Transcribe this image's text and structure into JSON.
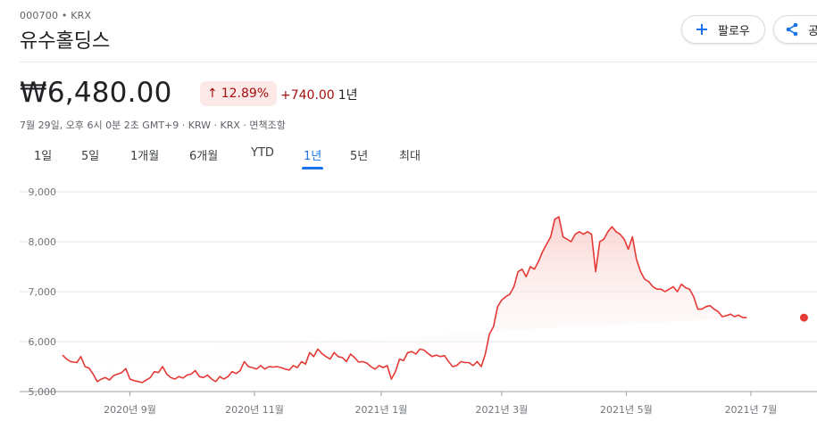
{
  "header": {
    "ticker": "000700 • KRX",
    "name": "유수홀딩스",
    "follow_label": "팔로우",
    "share_label": "공유"
  },
  "quote": {
    "price": "₩6,480.00",
    "pct_change": "12.89%",
    "change": "+740.00",
    "period": "1년",
    "meta": "7월 29일, 오후 6시 0분 2초 GMT+9 · KRW · KRX · 면책조항"
  },
  "tabs": [
    {
      "label": "1일",
      "active": false
    },
    {
      "label": "5일",
      "active": false
    },
    {
      "label": "1개월",
      "active": false
    },
    {
      "label": "6개월",
      "active": false
    },
    {
      "label": "YTD",
      "active": false
    },
    {
      "label": "1년",
      "active": true
    },
    {
      "label": "5년",
      "active": false
    },
    {
      "label": "최대",
      "active": false
    }
  ],
  "colors": {
    "line": "#e53935",
    "fill_top": "#f8c4c1",
    "down_badge_bg": "#fce8e6",
    "down_text": "#a50e0e",
    "accent": "#1a73e8"
  },
  "icons": {
    "follow": "plus-icon",
    "share": "share-icon"
  },
  "chart_data": {
    "type": "area",
    "ylim": [
      5000,
      9000
    ],
    "yticks": [
      "9,000",
      "8,000",
      "7,000",
      "6,000",
      "5,000"
    ],
    "ytick_values": [
      9000,
      8000,
      7000,
      6000,
      5000
    ],
    "xlim": [
      0,
      365
    ],
    "xticks": [
      {
        "label": "2020년 9월",
        "x": 33
      },
      {
        "label": "2020년 11월",
        "x": 94
      },
      {
        "label": "2021년 1월",
        "x": 156
      },
      {
        "label": "2021년 3월",
        "x": 215
      },
      {
        "label": "2021년 5월",
        "x": 276
      },
      {
        "label": "2021년 7월",
        "x": 337
      }
    ],
    "x": [
      0,
      2,
      4,
      7,
      9,
      11,
      13,
      15,
      17,
      19,
      21,
      23,
      25,
      27,
      29,
      31,
      33,
      35,
      37,
      39,
      41,
      43,
      45,
      47,
      49,
      51,
      53,
      55,
      57,
      59,
      61,
      63,
      65,
      67,
      69,
      71,
      73,
      75,
      77,
      79,
      81,
      83,
      85,
      87,
      89,
      91,
      93,
      95,
      97,
      99,
      101,
      103,
      105,
      107,
      109,
      111,
      113,
      115,
      117,
      119,
      121,
      123,
      125,
      127,
      129,
      131,
      133,
      135,
      137,
      139,
      141,
      143,
      145,
      147,
      149,
      151,
      153,
      155,
      157,
      159,
      161,
      163,
      165,
      167,
      169,
      171,
      173,
      175,
      177,
      179,
      181,
      183,
      185,
      187,
      189,
      191,
      193,
      195,
      197,
      199,
      201,
      203,
      205,
      207,
      209,
      211,
      213,
      215,
      217,
      219,
      221,
      223,
      225,
      227,
      229,
      231,
      233,
      235,
      237,
      239,
      241,
      243,
      245,
      247,
      249,
      251,
      253,
      255,
      257,
      259,
      261,
      263,
      265,
      267,
      269,
      271,
      273,
      275,
      277,
      279,
      281,
      283,
      285,
      287,
      289,
      291,
      293,
      295,
      297,
      299,
      301,
      303,
      305,
      307,
      309,
      311,
      313,
      315,
      317,
      319,
      321,
      323,
      325,
      327,
      329,
      331,
      333,
      335,
      337,
      339,
      341,
      343,
      345,
      347,
      349,
      351,
      353,
      355,
      357,
      359,
      361,
      363
    ],
    "values": [
      5730,
      5650,
      5600,
      5580,
      5700,
      5500,
      5470,
      5350,
      5200,
      5250,
      5280,
      5230,
      5320,
      5350,
      5380,
      5460,
      5250,
      5220,
      5200,
      5180,
      5230,
      5280,
      5400,
      5380,
      5500,
      5350,
      5280,
      5250,
      5300,
      5270,
      5330,
      5350,
      5420,
      5300,
      5280,
      5330,
      5250,
      5200,
      5300,
      5250,
      5300,
      5400,
      5360,
      5420,
      5600,
      5500,
      5480,
      5450,
      5520,
      5450,
      5500,
      5490,
      5500,
      5480,
      5450,
      5430,
      5520,
      5480,
      5600,
      5550,
      5780,
      5700,
      5850,
      5760,
      5700,
      5650,
      5780,
      5700,
      5680,
      5600,
      5750,
      5680,
      5590,
      5600,
      5570,
      5500,
      5450,
      5520,
      5480,
      5520,
      5250,
      5400,
      5650,
      5620,
      5780,
      5800,
      5750,
      5850,
      5830,
      5760,
      5700,
      5730,
      5700,
      5720,
      5600,
      5500,
      5520,
      5600,
      5580,
      5580,
      5520,
      5600,
      5500,
      5750,
      6150,
      6300,
      6700,
      6830,
      6900,
      6950,
      7100,
      7400,
      7450,
      7300,
      7500,
      7450,
      7600,
      7800,
      7950,
      8100,
      8450,
      8500,
      8100,
      8050,
      8000,
      8150,
      8200,
      8150,
      8200,
      8150,
      7400,
      8000,
      8050,
      8200,
      8300,
      8200,
      8150,
      8050,
      7850,
      8100,
      7650,
      7400,
      7250,
      7200,
      7100,
      7050,
      7050,
      7000,
      7050,
      7100,
      7000,
      7150,
      7080,
      7050,
      6900,
      6650,
      6650,
      6700,
      6720,
      6650,
      6600,
      6500,
      6520,
      6550,
      6500,
      6530,
      6480,
      6480
    ]
  }
}
